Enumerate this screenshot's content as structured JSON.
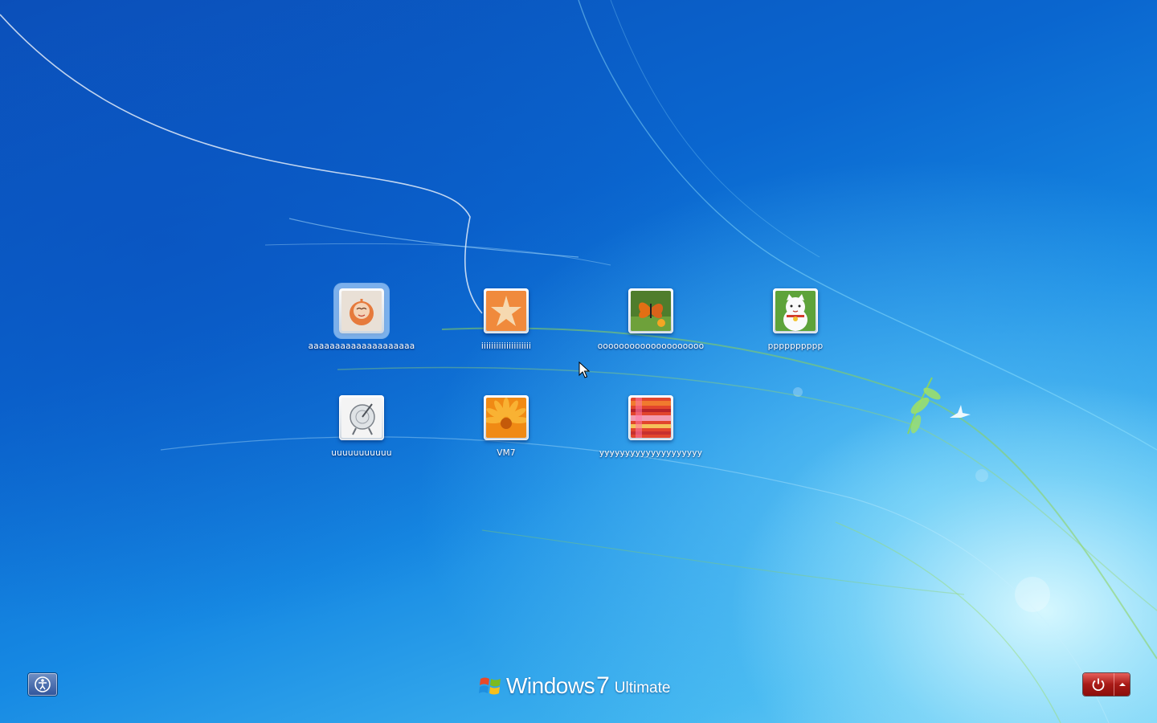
{
  "users": [
    {
      "name": "aaaaaaaaaaaaaaaaaaaa",
      "picture": "orange-chick-picture",
      "selected": true
    },
    {
      "name": "iiiiiiiiiiiiiiiiiiii",
      "picture": "starfish-picture",
      "selected": false
    },
    {
      "name": "oooooooooooooooooooo",
      "picture": "butterfly-picture",
      "selected": false
    },
    {
      "name": "pppppppppp",
      "picture": "lucky-cat-picture",
      "selected": false
    },
    {
      "name": "uuuuuuuuuuu",
      "picture": "satellite-dish-picture",
      "selected": false
    },
    {
      "name": "VM7",
      "picture": "orange-flower-picture",
      "selected": false
    },
    {
      "name": "yyyyyyyyyyyyyyyyyyyy",
      "picture": "striped-fabric-picture",
      "selected": false
    }
  ],
  "brand": {
    "name": "Windows",
    "version": "7",
    "edition": "Ultimate",
    "logo": "windows-flag-logo"
  },
  "controls": {
    "ease_of_access_icon": "ease-of-access-icon",
    "shutdown_icon": "power-icon",
    "shutdown_options_icon": "triangle-up-icon"
  },
  "colors": {
    "background_dark": "#0b4fb8",
    "background_light": "#7fd4f6",
    "shutdown_red": "#a81a16"
  }
}
